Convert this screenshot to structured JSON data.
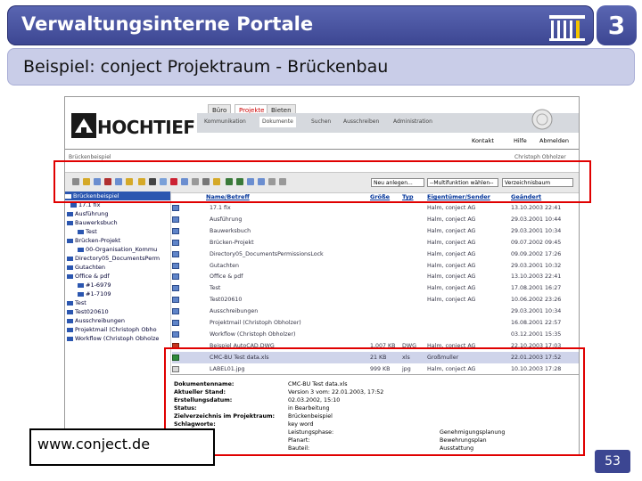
{
  "slide": {
    "title": "Verwaltungsinterne Portale",
    "number_badge": "3",
    "subtitle": "Beispiel: conject Projektraum - Brückenbau",
    "url": "www.conject.de",
    "page_number": "53",
    "colors": {
      "title_bar": "#3c4692",
      "subtitle_bar": "#c9cde8",
      "highlight": "#e00000"
    },
    "icon": "institution-columns-icon"
  },
  "app": {
    "logo_text": "HOCHTIEF",
    "top_tabs": [
      "Büro",
      "Projekte",
      "Bieten"
    ],
    "sub_tabs": [
      "Kommunikation",
      "Dokumente",
      "Suchen",
      "Ausschreiben",
      "Administration"
    ],
    "right_links": [
      "Kontakt",
      "Hilfe",
      "Abmelden"
    ],
    "breadcrumb_left": "Brückenbeispiel",
    "breadcrumb_right": "Christoph Obholzer",
    "toolbar": {
      "select_new": "Neu anlegen...",
      "select_multi": "--Multifunktion wählen--",
      "select_dir": "Verzeichnisbaum"
    },
    "tree": [
      "Brückenbeispiel",
      "17.1 fix",
      "Ausführung",
      "Bauwerksbuch",
      "Test",
      "Brücken-Projekt",
      "00-Organisation_Kommu",
      "Directory05_DocumentsPerm",
      "Gutachten",
      "Office & pdf",
      "#1-6979",
      "#1-7109",
      "Test",
      "Test020610",
      "Ausschreibungen",
      "Projektmail (Christoph Obho",
      "Workflow (Christoph Obholze"
    ],
    "list_headers": [
      "Name/Betreff",
      "Größe",
      "Typ",
      "Eigentümer/Sender",
      "Geändert"
    ],
    "rows": [
      {
        "name": "17.1 fix",
        "size": "",
        "type": "",
        "owner": "Halm, conject AG",
        "date": "13.10.2003 22:41"
      },
      {
        "name": "Ausführung",
        "size": "",
        "type": "",
        "owner": "Halm, conject AG",
        "date": "29.03.2001 10:44"
      },
      {
        "name": "Bauwerksbuch",
        "size": "",
        "type": "",
        "owner": "Halm, conject AG",
        "date": "29.03.2001 10:34"
      },
      {
        "name": "Brücken-Projekt",
        "size": "",
        "type": "",
        "owner": "Halm, conject AG",
        "date": "09.07.2002 09:45"
      },
      {
        "name": "Directory05_DocumentsPermissionsLock",
        "size": "",
        "type": "",
        "owner": "Halm, conject AG",
        "date": "09.09.2002 17:26"
      },
      {
        "name": "Gutachten",
        "size": "",
        "type": "",
        "owner": "Halm, conject AG",
        "date": "29.03.2001 10:32"
      },
      {
        "name": "Office & pdf",
        "size": "",
        "type": "",
        "owner": "Halm, conject AG",
        "date": "13.10.2003 22:41"
      },
      {
        "name": "Test",
        "size": "",
        "type": "",
        "owner": "Halm, conject AG",
        "date": "17.08.2001 16:27"
      },
      {
        "name": "Test020610",
        "size": "",
        "type": "",
        "owner": "Halm, conject AG",
        "date": "10.06.2002 23:26"
      },
      {
        "name": "Ausschreibungen",
        "size": "",
        "type": "",
        "owner": "",
        "date": "29.03.2001 10:34"
      },
      {
        "name": "Projektmail (Christoph Obholzer)",
        "size": "",
        "type": "",
        "owner": "",
        "date": "16.08.2001 22:57"
      },
      {
        "name": "Workflow (Christoph Obholzer)",
        "size": "",
        "type": "",
        "owner": "",
        "date": "03.12.2001 15:35"
      },
      {
        "name": "Beispiel AutoCAD.DWG",
        "size": "1,007 KB",
        "type": "DWG",
        "owner": "Halm, conject AG",
        "date": "22.10.2003 17:03"
      },
      {
        "name": "CMC-BU Test data.xls",
        "size": "21 KB",
        "type": "xls",
        "owner": "Großmuller",
        "date": "22.01.2003 17:52"
      },
      {
        "name": "LABEL01.jpg",
        "size": "999 KB",
        "type": "jpg",
        "owner": "Halm, conject AG",
        "date": "10.10.2003 17:28"
      }
    ],
    "detail": {
      "left": [
        {
          "label": "Dokumentenname:",
          "value": "CMC-BU Test data.xls"
        },
        {
          "label": "Aktueller Stand:",
          "value": "Version 3 vom: 22.01.2003, 17:52"
        },
        {
          "label": "Erstellungsdatum:",
          "value": "02.03.2002, 15:10"
        },
        {
          "label": "Status:",
          "value": "in Bearbeitung"
        },
        {
          "label": "Zielverzeichnis im Projektraum:",
          "value": "Brückenbeispiel"
        },
        {
          "label": "Schlagworte:",
          "value": "key word"
        }
      ],
      "right": [
        {
          "label": "Leistungsphase:",
          "value": "Genehmigungsplanung"
        },
        {
          "label": "Planart:",
          "value": "Bewehrungsplan"
        },
        {
          "label": "Bauteil:",
          "value": "Ausstattung"
        }
      ]
    }
  }
}
